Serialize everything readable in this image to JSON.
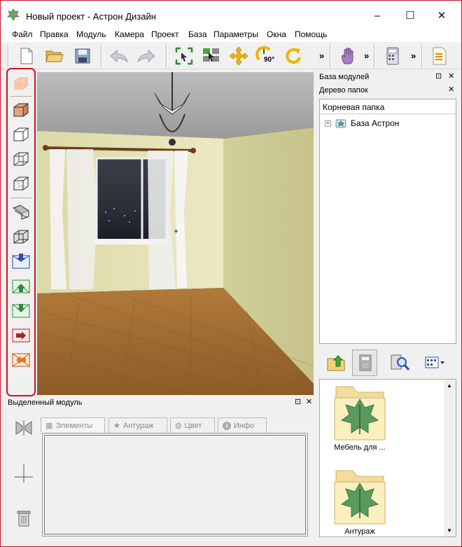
{
  "window": {
    "title": "Новый проект - Астрон Дизайн",
    "minimize": "–",
    "maximize": "☐",
    "close": "✕"
  },
  "menu": [
    "Файл",
    "Правка",
    "Модуль",
    "Камера",
    "Проект",
    "База",
    "Параметры",
    "Окна",
    "Помощь"
  ],
  "toolbar": {
    "overflow": "»",
    "rotate_label": "90°"
  },
  "panels": {
    "modules_base": "База модулей",
    "folder_tree": "Дерево папок",
    "pin": "⊡",
    "close": "✕",
    "selected_module": "Выделенный модуль"
  },
  "tree": {
    "header": "Корневая папка",
    "root_node": "База Астрон",
    "expander": "+"
  },
  "files": [
    {
      "label": "Мебель для ..."
    },
    {
      "label": "Антураж"
    }
  ],
  "tabs": [
    {
      "label": "Элементы",
      "icon": "grid-icon"
    },
    {
      "label": "Антураж",
      "icon": "star-icon"
    },
    {
      "label": "Цвет",
      "icon": "globe-icon"
    },
    {
      "label": "Инфо",
      "icon": "info-icon"
    }
  ],
  "colors": {
    "accent_red": "#d4111e",
    "wall": "#e6e4b4",
    "floor": "#b07a3a",
    "folder_leaf": "#5a9a5e"
  }
}
